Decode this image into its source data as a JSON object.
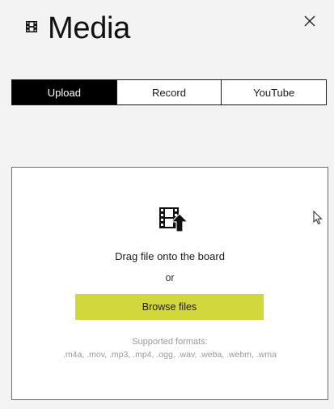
{
  "header": {
    "title": "Media"
  },
  "tabs": [
    {
      "label": "Upload",
      "active": true
    },
    {
      "label": "Record",
      "active": false
    },
    {
      "label": "YouTube",
      "active": false
    }
  ],
  "dropzone": {
    "drag_text": "Drag file onto the board",
    "or_text": "or",
    "browse_label": "Browse files",
    "formats_title": "Supported formats:",
    "formats_list": ".m4a, .mov, .mp3, .mp4, .ogg, .wav, .weba, .webm, .wma"
  },
  "colors": {
    "browse_button": "#d2d73b",
    "active_tab_bg": "#000000",
    "active_tab_text": "#ffffff",
    "muted_text": "#999999"
  },
  "icons": {
    "title": "film-icon",
    "close": "close-icon",
    "upload": "video-upload-icon",
    "cursor": "mouse-pointer-icon"
  }
}
